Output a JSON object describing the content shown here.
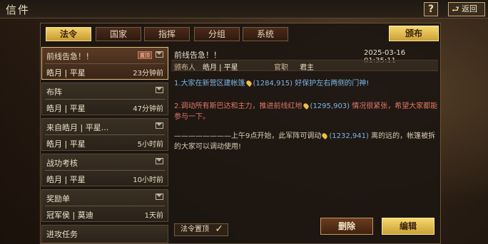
{
  "window": {
    "title": "信件"
  },
  "topbar": {
    "help_label": "?",
    "back_label": "返回"
  },
  "tabs": [
    {
      "label": "法令",
      "active": true
    },
    {
      "label": "国家",
      "active": false
    },
    {
      "label": "指挥",
      "active": false
    },
    {
      "label": "分组",
      "active": false
    },
    {
      "label": "系统",
      "active": false
    }
  ],
  "publish_label": "颁布",
  "list": [
    {
      "title": "前线告急！！",
      "pin_badge": "置顶",
      "sender": "皓月 | 平星",
      "time": "23分钟前",
      "selected": true
    },
    {
      "title": "布阵",
      "sender": "皓月 | 平星",
      "time": "47分钟前"
    },
    {
      "title": "来自皓月 | 平星...",
      "sender": "皓月 | 平星",
      "time": "5小时前"
    },
    {
      "title": "战功考核",
      "sender": "皓月 | 平星",
      "time": "10小时前"
    },
    {
      "title": "奖励单",
      "sender": "冠军侯 | 莫迪",
      "time": "1天前"
    },
    {
      "title": "进攻任务"
    }
  ],
  "detail": {
    "title": "前线告急！！",
    "date": "2025-03-16 01:35:11",
    "publisher_label": "颁布人",
    "publisher": "皓月 | 平星",
    "rank_label": "官职",
    "rank": "君主",
    "para1_a": "1.大家在新营区建帐篷",
    "para1_coord": "(1284,915)",
    "para1_b": "好保护左右两侧的门神!",
    "para2_a": "2.调动所有斯巴达和主力，推进前线红地",
    "para2_coord": "(1295,903)",
    "para2_b": "情况很紧张，希望大家都能参与一下。",
    "para3_a": "————————上午9点开始，此军阵可调动",
    "para3_coord": "(1232,941)",
    "para3_b": "离的远的，帐篷被拆的大家可以调动使用!"
  },
  "footer": {
    "pin_toggle_label": "法令置顶",
    "pin_checked": true,
    "delete_label": "删除",
    "edit_label": "编辑"
  },
  "colors": {
    "accent": "#f3d06a",
    "link": "#7ab6e8",
    "alert": "#e07868"
  }
}
